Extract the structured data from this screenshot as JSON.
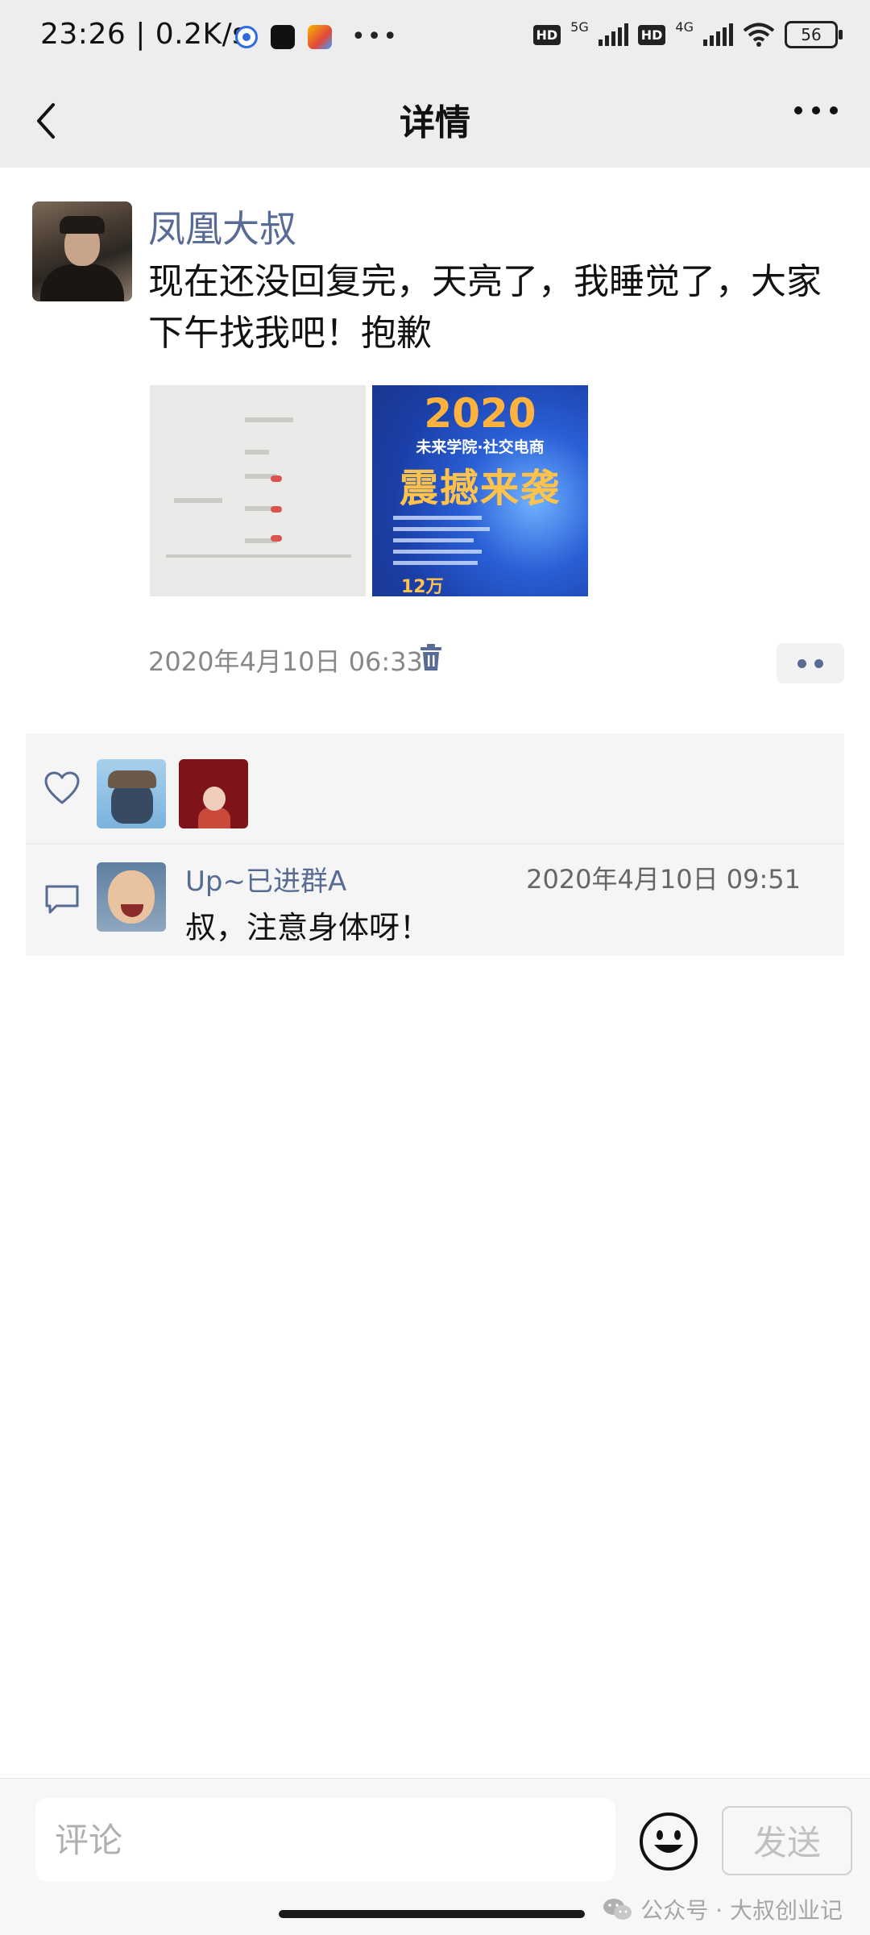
{
  "status_bar": {
    "time": "23:26 | 0.2K/s",
    "network_1": "5G",
    "network_2": "4G",
    "hd_label": "HD",
    "battery": "56"
  },
  "nav": {
    "title": "详情"
  },
  "post": {
    "author": "凤凰大叔",
    "text": "现在还没回复完，天亮了，我睡觉了，大家下午找我吧！抱歉",
    "time": "2020年4月10日 06:33",
    "images": [
      {
        "name": "screenshot"
      },
      {
        "name": "poster",
        "year": "2020",
        "subtitle": "未来学院·社交电商",
        "headline": "震撼来袭",
        "footer_amount": "12万"
      }
    ]
  },
  "likes": {
    "count": 2
  },
  "comments": [
    {
      "author": "Up~已进群A",
      "time": "2020年4月10日 09:51",
      "text": "叔，注意身体呀！"
    }
  ],
  "input": {
    "placeholder": "评论",
    "send_label": "发送"
  },
  "watermark": {
    "text": "公众号 · 大叔创业记"
  },
  "colors": {
    "link_blue": "#576b95",
    "bar_gray": "#ededed",
    "panel_gray": "#f5f5f5"
  }
}
